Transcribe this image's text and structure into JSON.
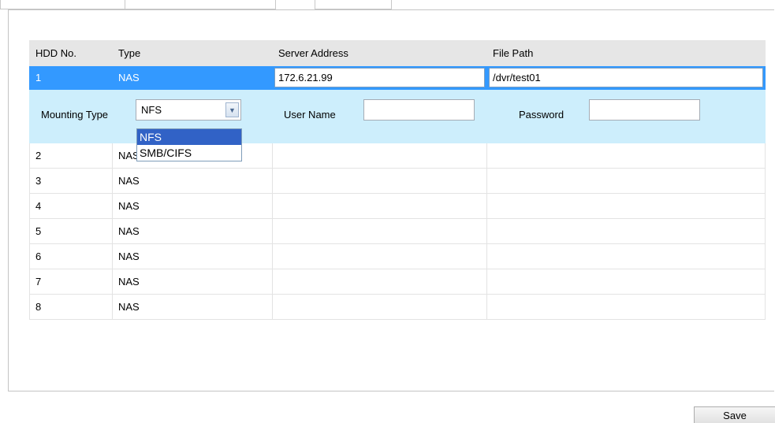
{
  "table": {
    "headers": [
      "HDD No.",
      "Type",
      "Server Address",
      "File Path"
    ],
    "selected_row": {
      "hdd_no": "1",
      "type": "NAS",
      "server_address": "172.6.21.99",
      "file_path": "/dvr/test01"
    },
    "mounting": {
      "mounting_type_label": "Mounting Type",
      "mounting_type_value": "NFS",
      "mounting_type_options": [
        "NFS",
        "SMB/CIFS"
      ],
      "user_name_label": "User Name",
      "user_name_value": "",
      "password_label": "Password",
      "password_value": ""
    },
    "rows": [
      {
        "hdd_no": "2",
        "type": "NAS"
      },
      {
        "hdd_no": "3",
        "type": "NAS"
      },
      {
        "hdd_no": "4",
        "type": "NAS"
      },
      {
        "hdd_no": "5",
        "type": "NAS"
      },
      {
        "hdd_no": "6",
        "type": "NAS"
      },
      {
        "hdd_no": "7",
        "type": "NAS"
      },
      {
        "hdd_no": "8",
        "type": "NAS"
      }
    ]
  },
  "footer": {
    "save_label": "Save"
  },
  "colors": {
    "selected_row": "#3399ff",
    "detail_row": "#cdeefc",
    "header_row": "#e6e6e6",
    "option_highlight": "#3162c6"
  }
}
